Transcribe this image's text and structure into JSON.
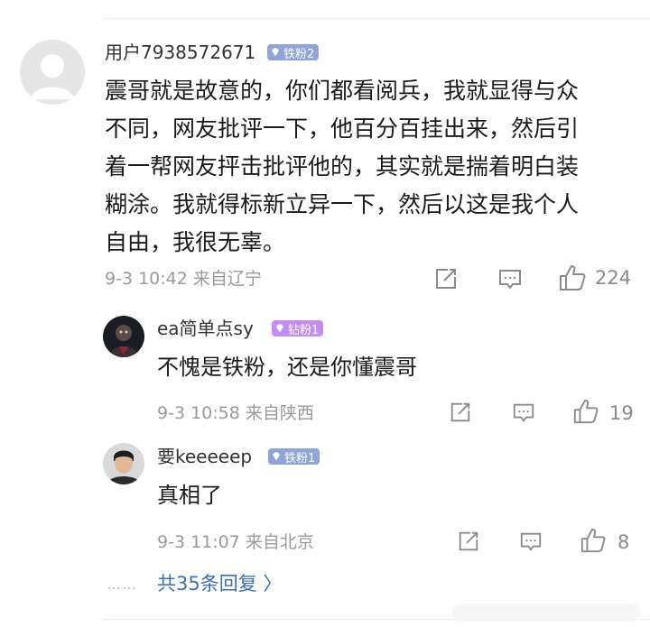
{
  "comment": {
    "username": "用户7938572671",
    "badge": "铁粉2",
    "content_lines": [
      "震哥就是故意的，你们都看阅兵，我就显得与众",
      "不同，网友批评一下，他百分百挂出来，然后引",
      "着一帮网友抨击批评他的，其实就是揣着明白装",
      "糊涂。我就得标新立异一下，然后以这是我个人",
      "自由，我很无辜。"
    ],
    "meta": "9-3 10:42  来自辽宁",
    "likes": "224"
  },
  "replies": [
    {
      "username": "ea简单点sy",
      "badge": "钻粉1",
      "content": "不愧是铁粉，还是你懂震哥",
      "meta": "9-3 10:58  来自陕西",
      "likes": "19"
    },
    {
      "username": "要keeeeep",
      "badge": "铁粉1",
      "content": "真相了",
      "meta": "9-3 11:07  来自北京",
      "likes": "8"
    }
  ],
  "more_replies": {
    "dots": "……",
    "label": "共35条回复 〉"
  },
  "colors": {
    "iron_badge": "#8fa5d8",
    "diamond_badge": "#c48ef0",
    "link": "#3e6fae",
    "meta": "#9a9a9a"
  },
  "icons": [
    "share-icon",
    "comment-icon",
    "thumbs-up-icon",
    "gem-icon",
    "default-avatar-icon"
  ]
}
